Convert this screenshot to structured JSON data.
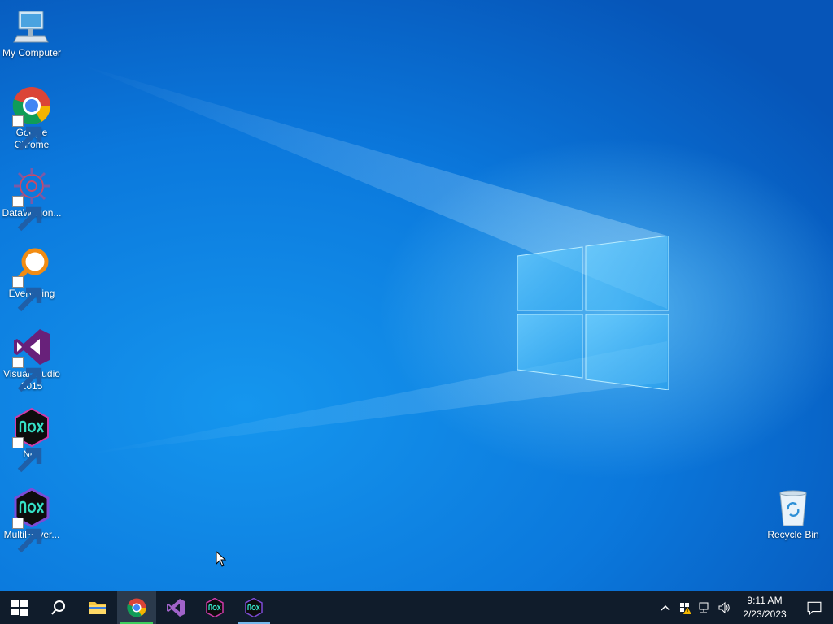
{
  "desktop": {
    "icons": [
      {
        "label": "My Computer",
        "icon": "computer-icon",
        "shortcut": false
      },
      {
        "label": "Google\nChrome",
        "icon": "chrome-icon",
        "shortcut": true
      },
      {
        "label": "DataWagon...",
        "icon": "datawagon-icon",
        "shortcut": true
      },
      {
        "label": "Everything",
        "icon": "everything-search-icon",
        "shortcut": true
      },
      {
        "label": "Visual Studio\n2015",
        "icon": "visual-studio-icon",
        "shortcut": true
      },
      {
        "label": "Nox",
        "icon": "nox-icon",
        "shortcut": true
      },
      {
        "label": "MultiPlayer...",
        "icon": "nox-multiplayer-icon",
        "shortcut": true
      },
      {
        "label": "Recycle Bin",
        "icon": "recycle-bin-icon",
        "shortcut": false
      }
    ]
  },
  "taskbar": {
    "buttons": [
      {
        "name": "start",
        "icon": "windows-start-icon"
      },
      {
        "name": "search",
        "icon": "search-icon"
      },
      {
        "name": "file-explorer",
        "icon": "folder-icon"
      },
      {
        "name": "chrome",
        "icon": "chrome-icon",
        "active": true
      },
      {
        "name": "visual-studio",
        "icon": "visual-studio-icon"
      },
      {
        "name": "nox",
        "icon": "nox-icon"
      },
      {
        "name": "nox-multiplayer",
        "icon": "nox-multiplayer-icon",
        "running": true
      }
    ],
    "tray": {
      "time": "9:11 AM",
      "date": "2/23/2023",
      "icons": [
        "chevron-up-icon",
        "security-warning-icon",
        "network-icon",
        "volume-icon",
        "notification-icon"
      ]
    }
  },
  "colors": {
    "taskbar_bg": "#101c2b",
    "accent": "#76b9ed",
    "wallpaper_blue": "#0b78dc"
  }
}
